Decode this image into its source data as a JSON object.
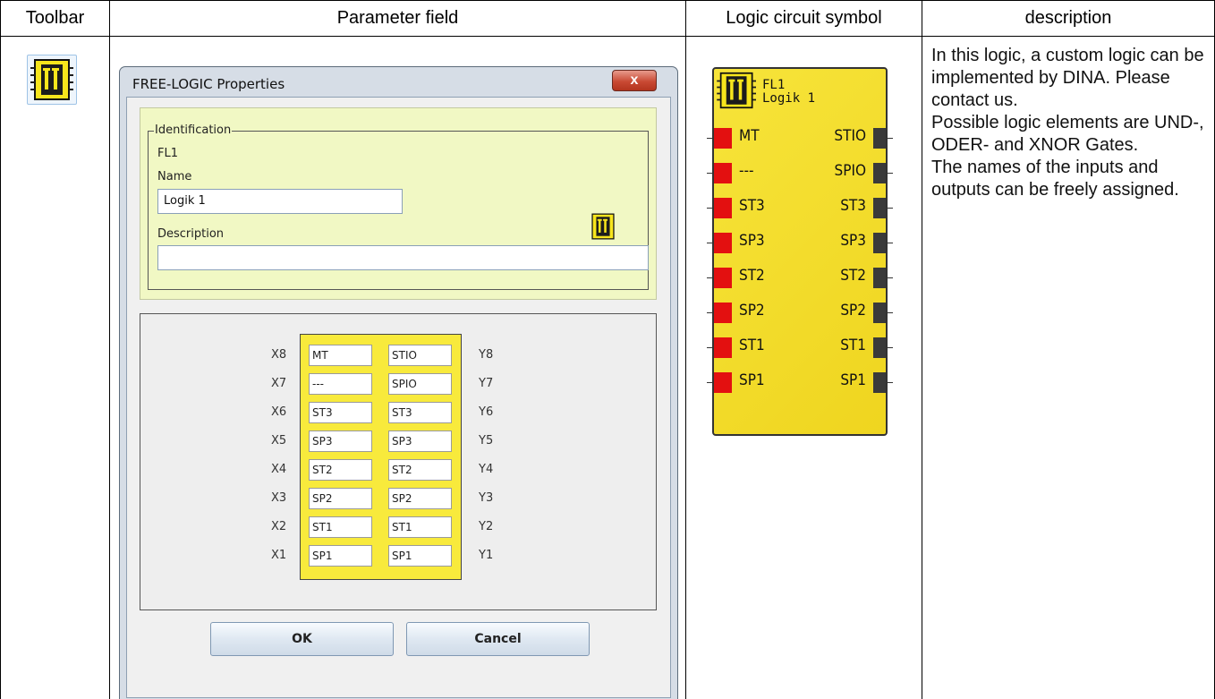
{
  "table": {
    "headers": [
      "Toolbar",
      "Parameter field",
      "Logic circuit symbol",
      "description"
    ]
  },
  "toolbar": {
    "icon": "free-logic-chip-icon"
  },
  "dialog": {
    "title": "FREE-LOGIC Properties",
    "close_label": "x",
    "identification": {
      "legend": "Identification",
      "id": "FL1",
      "name_label": "Name",
      "name_value": "Logik 1",
      "description_label": "Description",
      "description_value": ""
    },
    "io": {
      "rows": [
        {
          "x_label": "X8",
          "input": "MT",
          "output": "STIO",
          "y_label": "Y8"
        },
        {
          "x_label": "X7",
          "input": "---",
          "output": "SPIO",
          "y_label": "Y7"
        },
        {
          "x_label": "X6",
          "input": "ST3",
          "output": "ST3",
          "y_label": "Y6"
        },
        {
          "x_label": "X5",
          "input": "SP3",
          "output": "SP3",
          "y_label": "Y5"
        },
        {
          "x_label": "X4",
          "input": "ST2",
          "output": "ST2",
          "y_label": "Y4"
        },
        {
          "x_label": "X3",
          "input": "SP2",
          "output": "SP2",
          "y_label": "Y3"
        },
        {
          "x_label": "X2",
          "input": "ST1",
          "output": "ST1",
          "y_label": "Y2"
        },
        {
          "x_label": "X1",
          "input": "SP1",
          "output": "SP1",
          "y_label": "Y1"
        }
      ]
    },
    "ok_label": "OK",
    "cancel_label": "Cancel"
  },
  "symbol": {
    "id": "FL1",
    "name": "Logik 1",
    "inputs": [
      "MT",
      "---",
      "ST3",
      "SP3",
      "ST2",
      "SP2",
      "ST1",
      "SP1"
    ],
    "outputs": [
      "STIO",
      "SPIO",
      "ST3",
      "SP3",
      "ST2",
      "SP2",
      "ST1",
      "SP1"
    ],
    "colors": {
      "input_pin": "#e31010",
      "output_pin": "#3a3a3a",
      "body": "#f2dd2a"
    }
  },
  "description": {
    "lines": [
      "In this logic, a custom logic can be implemented by DINA. Please contact us.",
      "Possible logic elements are UND-, ODER- and XNOR Gates.",
      "The names of the inputs and outputs can be freely assigned."
    ]
  }
}
